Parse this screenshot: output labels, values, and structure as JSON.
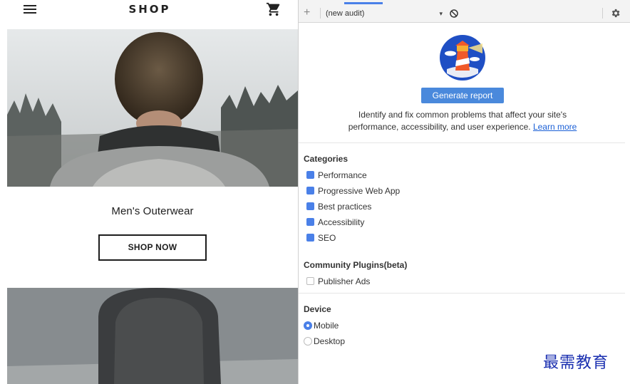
{
  "shop": {
    "title": "SHOP",
    "menu_icon": "hamburger-menu-icon",
    "cart_icon": "shopping-cart-icon",
    "product": {
      "title": "Men's Outerwear",
      "cta_label": "SHOP NOW"
    }
  },
  "devtools": {
    "toolbar": {
      "add_icon": "plus-icon",
      "audit_select": "(new audit)",
      "caret": "▾",
      "clear_icon": "block-icon",
      "settings_icon": "gear-icon"
    },
    "logo_icon": "lighthouse-icon",
    "generate_label": "Generate report",
    "intro_line1": "Identify and fix common problems that affect your site's",
    "intro_line2": "performance, accessibility, and user experience.",
    "learn_more": "Learn more",
    "categories": {
      "title": "Categories",
      "items": [
        {
          "label": "Performance",
          "checked": true
        },
        {
          "label": "Progressive Web App",
          "checked": true
        },
        {
          "label": "Best practices",
          "checked": true
        },
        {
          "label": "Accessibility",
          "checked": true
        },
        {
          "label": "SEO",
          "checked": true
        }
      ]
    },
    "plugins": {
      "title": "Community Plugins(beta)",
      "items": [
        {
          "label": "Publisher Ads",
          "checked": false
        }
      ]
    },
    "device": {
      "title": "Device",
      "options": [
        {
          "label": "Mobile",
          "selected": true
        },
        {
          "label": "Desktop",
          "selected": false
        }
      ]
    }
  },
  "watermark": "最需教育",
  "colors": {
    "accent": "#4a80e8",
    "button": "#4a89dc",
    "link": "#1a5fd6",
    "watermark": "#1a2fb0"
  }
}
